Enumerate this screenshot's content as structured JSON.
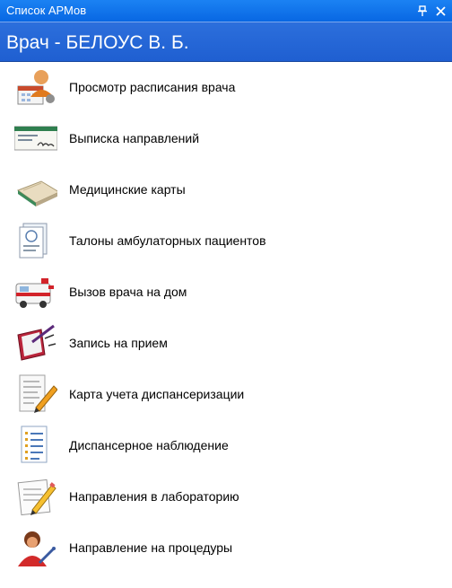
{
  "panel": {
    "title": "Список АРМов",
    "pin_glyph": "ᵖ",
    "close_glyph": "✕"
  },
  "header": {
    "title": "Врач - БЕЛОУС В. Б."
  },
  "items": [
    {
      "label": "Просмотр расписания врача",
      "icon": "doctor-schedule-icon"
    },
    {
      "label": "Выписка направлений",
      "icon": "referral-document-icon"
    },
    {
      "label": "Медицинские карты",
      "icon": "medical-cards-icon"
    },
    {
      "label": "Талоны амбулаторных пациентов",
      "icon": "outpatient-ticket-icon"
    },
    {
      "label": "Вызов врача на дом",
      "icon": "ambulance-icon"
    },
    {
      "label": "Запись на прием",
      "icon": "appointment-book-icon"
    },
    {
      "label": "Карта учета диспансеризации",
      "icon": "dispensary-card-icon"
    },
    {
      "label": "Диспансерное наблюдение",
      "icon": "checklist-icon"
    },
    {
      "label": "Направления в лабораторию",
      "icon": "lab-referral-icon"
    },
    {
      "label": "Направление на процедуры",
      "icon": "procedures-icon"
    }
  ]
}
